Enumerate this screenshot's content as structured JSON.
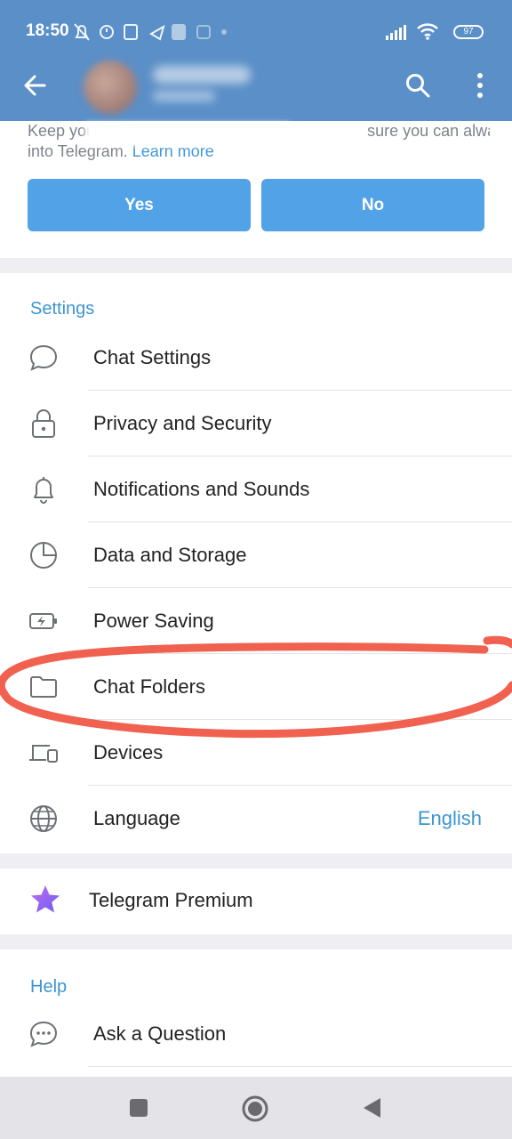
{
  "status_bar": {
    "time": "18:50",
    "battery": "97"
  },
  "suggestion": {
    "text_before": "Keep your",
    "text_after": "sure you can always log",
    "line2": "into Telegram. ",
    "link": "Learn more",
    "yes_label": "Yes",
    "no_label": "No"
  },
  "settings": {
    "title": "Settings",
    "items": [
      {
        "label": "Chat Settings",
        "icon": "chat-bubble-icon"
      },
      {
        "label": "Privacy and Security",
        "icon": "lock-icon"
      },
      {
        "label": "Notifications and Sounds",
        "icon": "bell-icon"
      },
      {
        "label": "Data and Storage",
        "icon": "pie-clock-icon"
      },
      {
        "label": "Power Saving",
        "icon": "battery-bolt-icon"
      },
      {
        "label": "Chat Folders",
        "icon": "folder-icon"
      },
      {
        "label": "Devices",
        "icon": "devices-icon"
      },
      {
        "label": "Language",
        "icon": "globe-icon",
        "value": "English"
      }
    ]
  },
  "premium": {
    "label": "Telegram Premium",
    "icon": "star-icon"
  },
  "help": {
    "title": "Help",
    "items": [
      {
        "label": "Ask a Question",
        "icon": "chat-dots-icon"
      }
    ]
  },
  "colors": {
    "header": "#5b8fc7",
    "accent": "#3d95d1",
    "button": "#52a2e8",
    "annotation": "#f0614f"
  }
}
